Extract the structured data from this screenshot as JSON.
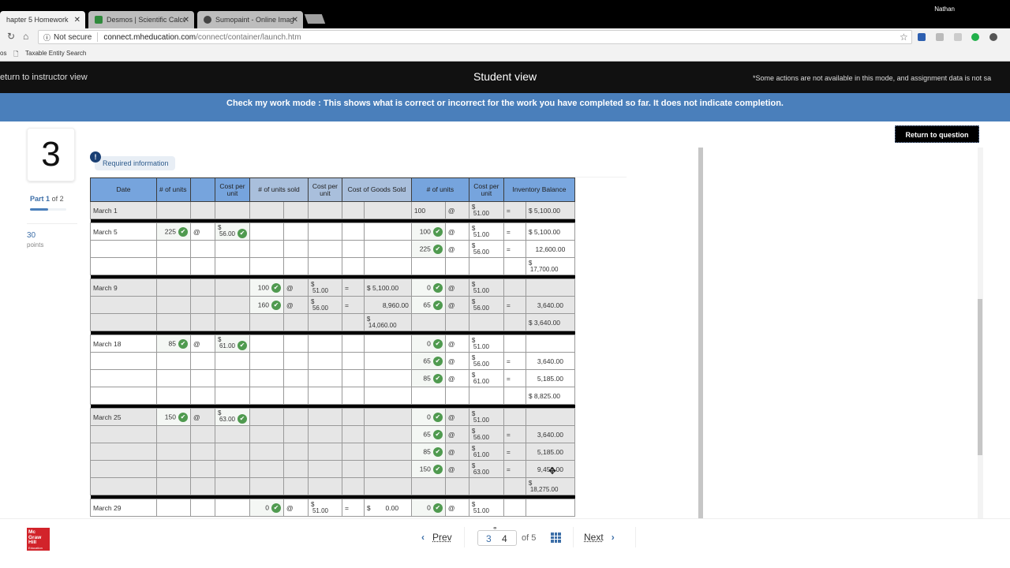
{
  "browser": {
    "tabs": [
      {
        "label": "hapter 5 Homework",
        "active": true
      },
      {
        "label": "Desmos | Scientific Calcu",
        "active": false
      },
      {
        "label": "Sumopaint - Online Imag",
        "active": false
      }
    ],
    "user": "Nathan",
    "security": "Not secure",
    "url_domain": "connect.mheducation.com",
    "url_path": "/connect/container/launch.htm",
    "bookmarks": [
      "os",
      "Taxable Entity Search"
    ]
  },
  "modebar": {
    "return_label": "eturn to instructor view",
    "title": "Student view",
    "note": "*Some actions are not available in this mode, and assignment data is not sa"
  },
  "checkbar": {
    "text": "Check my work mode : This shows what is correct or incorrect for the work you have completed so far. It does not indicate completion."
  },
  "question": {
    "number": "3",
    "part_label": "Part",
    "part_num": "1",
    "part_of": "of 2",
    "part_progress": 0.5,
    "points": "30",
    "points_label": "points",
    "required_info": "Required information",
    "return_to_question": "Return to question"
  },
  "table": {
    "headers": {
      "date": "Date",
      "units": "# of units",
      "cost_per_unit": "Cost per unit",
      "units_sold": "# of units sold",
      "cost_per_unit_sold": "Cost per unit",
      "cogs": "Cost of Goods Sold",
      "bal_units": "# of units",
      "bal_cost": "Cost per unit",
      "inv_balance": "Inventory Balance"
    },
    "at": "@",
    "eq": "=",
    "dollar": "$",
    "rows": [
      {
        "bg": "gr",
        "date": "March 1",
        "bal_units": "100",
        "bal_cost": "51.00",
        "bal_eq": "=",
        "bal_total": "$ 5,100.00"
      },
      {
        "sep": true
      },
      {
        "bg": "wh",
        "date": "March 5",
        "p_units": "225",
        "p_cost": "56.00",
        "bal_units": "100",
        "bal_cost": "51.00",
        "bal_eq": "=",
        "bal_total": "$ 5,100.00",
        "bal_check": true
      },
      {
        "bg": "wh",
        "bal_units": "225",
        "bal_cost": "56.00",
        "bal_eq": "=",
        "bal_total": "12,600.00",
        "bal_check": true
      },
      {
        "bg": "wh",
        "bal_sum": "17,700.00"
      },
      {
        "sep": true
      },
      {
        "bg": "gr",
        "date": "March 9",
        "s_units": "100",
        "s_cost": "51.00",
        "s_eq": "=",
        "s_total": "$ 5,100.00",
        "bal_units": "0",
        "bal_cost": "51.00",
        "bal_check": true
      },
      {
        "bg": "gr",
        "s_units": "160",
        "s_cost": "56.00",
        "s_eq": "=",
        "s_total": "8,960.00",
        "bal_units": "65",
        "bal_cost": "56.00",
        "bal_eq": "=",
        "bal_total": "3,640.00",
        "bal_check": true
      },
      {
        "bg": "gr",
        "s_sum": "14,060.00",
        "bal_total": "$ 3,640.00"
      },
      {
        "sep": true
      },
      {
        "bg": "wh",
        "date": "March 18",
        "p_units": "85",
        "p_cost": "61.00",
        "bal_units": "0",
        "bal_cost": "51.00",
        "bal_check": true
      },
      {
        "bg": "wh",
        "bal_units": "65",
        "bal_cost": "56.00",
        "bal_eq": "=",
        "bal_total": "3,640.00",
        "bal_check": true
      },
      {
        "bg": "wh",
        "bal_units": "85",
        "bal_cost": "61.00",
        "bal_eq": "=",
        "bal_total": "5,185.00",
        "bal_check": true
      },
      {
        "bg": "wh",
        "bal_total": "$ 8,825.00"
      },
      {
        "sep": true
      },
      {
        "bg": "gr",
        "date": "March 25",
        "p_units": "150",
        "p_cost": "63.00",
        "bal_units": "0",
        "bal_cost": "51.00",
        "bal_check": true
      },
      {
        "bg": "gr",
        "bal_units": "65",
        "bal_cost": "56.00",
        "bal_eq": "=",
        "bal_total": "3,640.00",
        "bal_check": true
      },
      {
        "bg": "gr",
        "bal_units": "85",
        "bal_cost": "61.00",
        "bal_eq": "=",
        "bal_total": "5,185.00",
        "bal_check": true
      },
      {
        "bg": "gr",
        "bal_units": "150",
        "bal_cost": "63.00",
        "bal_eq": "=",
        "bal_total": "9,450.00",
        "bal_check": true
      },
      {
        "bg": "gr",
        "bal_sum": "18,275.00"
      },
      {
        "sep": true
      },
      {
        "bg": "wh",
        "date": "March 29",
        "s_units": "0",
        "s_cost": "51.00",
        "s_eq": "=",
        "s_total": "$        0.00",
        "bal_units": "0",
        "bal_cost": "51.00",
        "bal_check": true
      }
    ]
  },
  "pager": {
    "prev": "Prev",
    "current": "3",
    "next_page": "4",
    "of": "of 5",
    "next": "Next"
  },
  "logo": {
    "line1": "Mc",
    "line2": "Graw",
    "line3": "Hill",
    "line4": "Education"
  }
}
